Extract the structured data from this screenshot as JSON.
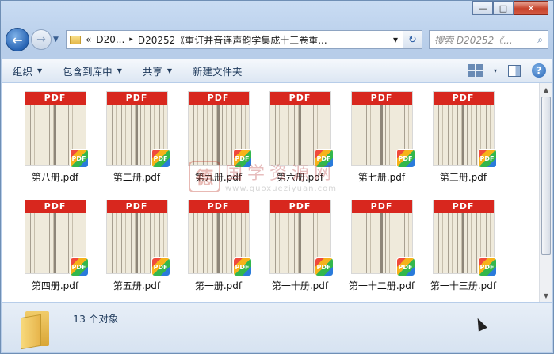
{
  "window": {
    "minimize": "—",
    "maximize": "□",
    "close": "✕"
  },
  "nav": {
    "back_icon": "←",
    "forward_icon": "→",
    "history_icon": "▼"
  },
  "address": {
    "chevron": "«",
    "seg1": "D20...",
    "sep": "▸",
    "seg2": "D20252《重订并音连声韵学集成十三卷重...",
    "dropdown": "▾",
    "refresh_icon": "↻"
  },
  "search": {
    "placeholder": "搜索 D20252《...",
    "icon": "⌕"
  },
  "toolbar": {
    "organize": "组织",
    "include": "包含到库中",
    "share": "共享",
    "new_folder": "新建文件夹",
    "arrow": "▼",
    "view_arrow": "▾",
    "help": "?"
  },
  "files": [
    {
      "name": "第八册.pdf"
    },
    {
      "name": "第二册.pdf"
    },
    {
      "name": "第九册.pdf"
    },
    {
      "name": "第六册.pdf"
    },
    {
      "name": "第七册.pdf"
    },
    {
      "name": "第三册.pdf"
    },
    {
      "name": "第四册.pdf"
    },
    {
      "name": "第五册.pdf"
    },
    {
      "name": "第一册.pdf"
    },
    {
      "name": "第一十册.pdf"
    },
    {
      "name": "第一十二册.pdf"
    },
    {
      "name": "第一十三册.pdf"
    }
  ],
  "thumb": {
    "header": "PDF",
    "badge": "PDF"
  },
  "watermark": {
    "seal": "德",
    "text": "国学资源网",
    "url": "www.guoxueziyuan.com"
  },
  "status": {
    "count": "13 个对象"
  },
  "scroll": {
    "up": "▲",
    "down": "▼"
  }
}
